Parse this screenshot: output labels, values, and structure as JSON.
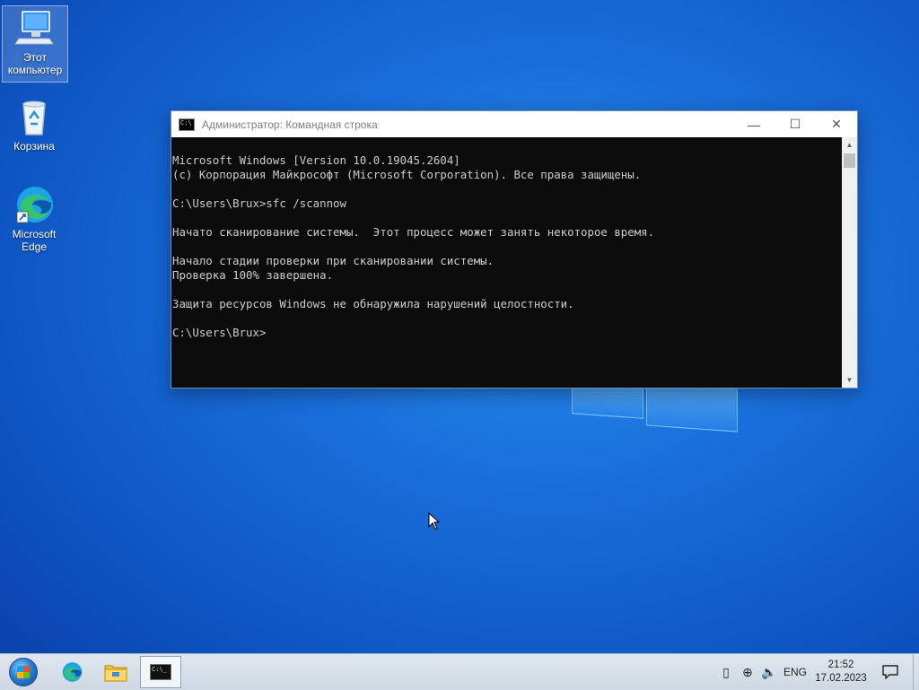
{
  "desktop": {
    "icons": [
      {
        "label": "Этот компьютер"
      },
      {
        "label": "Корзина"
      },
      {
        "label": "Microsoft Edge"
      }
    ]
  },
  "window": {
    "title": "Администратор: Командная строка",
    "controls": {
      "minimize": "—",
      "maximize": "☐",
      "close": "✕"
    },
    "console_lines": [
      "Microsoft Windows [Version 10.0.19045.2604]",
      "(c) Корпорация Майкрософт (Microsoft Corporation). Все права защищены.",
      "",
      "C:\\Users\\Brux>sfc /scannow",
      "",
      "Начато сканирование системы.  Этот процесс может занять некоторое время.",
      "",
      "Начало стадии проверки при сканировании системы.",
      "Проверка 100% завершена.",
      "",
      "Защита ресурсов Windows не обнаружила нарушений целостности.",
      "",
      "C:\\Users\\Brux>"
    ]
  },
  "taskbar": {
    "tray": {
      "lang": "ENG",
      "time": "21:52",
      "date": "17.02.2023"
    }
  },
  "colors": {
    "console_bg": "#0c0c0c",
    "console_text": "#cccccc",
    "desktop_accent": "#1a6fdc"
  }
}
